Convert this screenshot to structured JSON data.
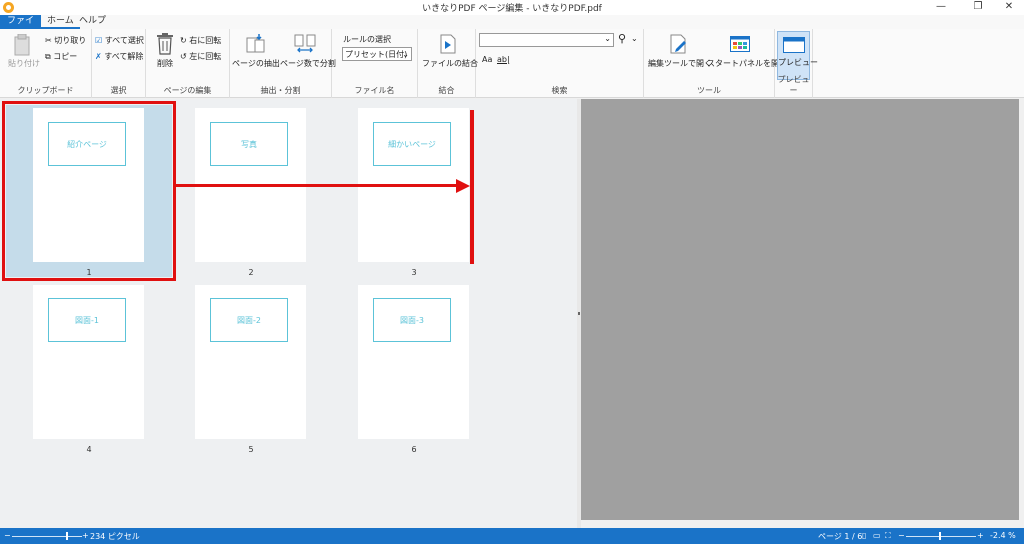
{
  "window": {
    "title": "いきなりPDF ページ編集 - いきなりPDF.pdf",
    "minimize": "—",
    "maximize": "❐",
    "close": "✕"
  },
  "menu": {
    "file": "ファイル",
    "home": "ホーム",
    "help": "ヘルプ"
  },
  "ribbon": {
    "clipboard": {
      "label": "クリップボード",
      "paste": "貼り付け",
      "cut": "切り取り",
      "copy": "コピー"
    },
    "select": {
      "label": "選択",
      "select_all": "すべて選択",
      "deselect_all": "すべて解除"
    },
    "page_edit": {
      "label": "ページの編集",
      "delete": "削除",
      "rotate_right": "右に回転",
      "rotate_left": "左に回転"
    },
    "extract": {
      "label": "抽出・分割",
      "extract_pages": "ページの抽出",
      "split_by_count": "ページ数で分割"
    },
    "filename": {
      "label": "ファイル名",
      "rule_title": "ルールの選択",
      "rule_value": "プリセット(日付)"
    },
    "merge": {
      "label": "結合",
      "merge_files": "ファイルの結合"
    },
    "search": {
      "label": "検索",
      "value": "",
      "case_label": "Aa",
      "word_label": "ab|"
    },
    "tools": {
      "label": "ツール",
      "open_editor": "編集ツールで開く",
      "open_start_panel": "スタートパネルを開く"
    },
    "preview": {
      "label": "プレビュー",
      "button": "プレビュー"
    }
  },
  "pages": [
    {
      "num": "1",
      "label": "紹介ページ",
      "selected": true
    },
    {
      "num": "2",
      "label": "写真",
      "selected": false
    },
    {
      "num": "3",
      "label": "細かいページ",
      "selected": false
    },
    {
      "num": "4",
      "label": "図面-1",
      "selected": false
    },
    {
      "num": "5",
      "label": "図面-2",
      "selected": false
    },
    {
      "num": "6",
      "label": "図面-3",
      "selected": false
    }
  ],
  "status": {
    "thumb_size": "234 ピクセル",
    "minus": "−",
    "plus": "+",
    "page_indicator": "ページ 1 / 6",
    "zoom": "-2.4 %"
  },
  "colors": {
    "accent": "#1a73c8",
    "annotation": "#e01010",
    "page_box": "#5cc3d8",
    "selection": "#c5dcea"
  }
}
